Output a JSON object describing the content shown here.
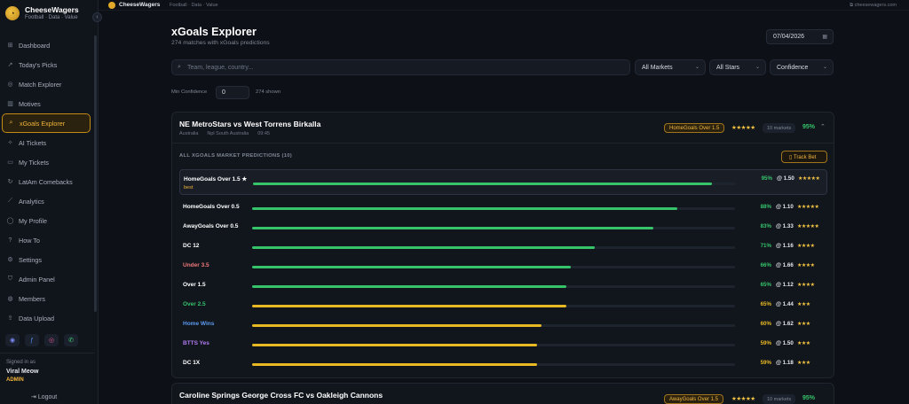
{
  "brand": {
    "name": "CheeseWagers",
    "tagline": "Football · Data · Value"
  },
  "nav": [
    {
      "label": "Dashboard",
      "icon": "grid-icon",
      "glyph": "⊞"
    },
    {
      "label": "Today's Picks",
      "icon": "trend-icon",
      "glyph": "↗"
    },
    {
      "label": "Match Explorer",
      "icon": "compass-icon",
      "glyph": "◎"
    },
    {
      "label": "Motives",
      "icon": "bar-icon",
      "glyph": "▥"
    },
    {
      "label": "xGoals Explorer",
      "icon": "search-icon",
      "glyph": "⌕",
      "active": true
    },
    {
      "label": "AI Tickets",
      "icon": "spark-icon",
      "glyph": "✧"
    },
    {
      "label": "My Tickets",
      "icon": "ticket-icon",
      "glyph": "▭"
    },
    {
      "label": "LatAm Comebacks",
      "icon": "cycle-icon",
      "glyph": "↻"
    },
    {
      "label": "Analytics",
      "icon": "chart-line-icon",
      "glyph": "⟋"
    },
    {
      "label": "My Profile",
      "icon": "user-icon",
      "glyph": "◯"
    },
    {
      "label": "How To",
      "icon": "help-icon",
      "glyph": "?"
    },
    {
      "label": "Settings",
      "icon": "gear-icon",
      "glyph": "⚙"
    },
    {
      "label": "Admin Panel",
      "icon": "shield-icon",
      "glyph": "⛉"
    },
    {
      "label": "Members",
      "icon": "users-icon",
      "glyph": "◍"
    },
    {
      "label": "Data Upload",
      "icon": "upload-icon",
      "glyph": "⇪"
    }
  ],
  "user": {
    "signed_in": "Signed in as",
    "name": "Viral Meow",
    "role": "ADMIN",
    "logout": "Logout"
  },
  "topbar": {
    "name": "CheeseWagers",
    "tagline": "Football · Data · Value",
    "site": "cheesewagers.com"
  },
  "header": {
    "title": "xGoals Explorer",
    "subtitle": "274 matches with xGoals predictions",
    "date": "07/04/2026"
  },
  "filters": {
    "search_placeholder": "Team, league, country...",
    "markets": "All Markets",
    "stars": "All Stars",
    "sort": "Confidence",
    "min_conf_label": "Min Confidence",
    "min_conf_value": "0",
    "shown": "274 shown"
  },
  "match1": {
    "name": "NE MetroStars vs West Torrens Birkalla",
    "country": "Australia",
    "league": "Npl South Australia",
    "time": "09:45",
    "badge": "HomeGoals Over 1.5",
    "stars": "★★★★★",
    "markets": "10 markets",
    "pct": "95%",
    "section": "ALL XGOALS MARKET PREDICTIONS (10)",
    "track": "Track Bet",
    "best_tag": "best",
    "rows": [
      {
        "label": "HomeGoals Over 1.5 ★",
        "value": 95,
        "pct": "95%",
        "odds": "@ 1.50",
        "stars": "★★★★★",
        "color": "#35c46a",
        "label_color": "#ffffff",
        "best": true
      },
      {
        "label": "HomeGoals Over 0.5",
        "value": 88,
        "pct": "88%",
        "odds": "@ 1.10",
        "stars": "★★★★★",
        "color": "#35c46a",
        "label_color": "#ffffff"
      },
      {
        "label": "AwayGoals Over 0.5",
        "value": 83,
        "pct": "83%",
        "odds": "@ 1.33",
        "stars": "★★★★★",
        "color": "#35c46a",
        "label_color": "#ffffff"
      },
      {
        "label": "DC 12",
        "value": 71,
        "pct": "71%",
        "odds": "@ 1.16",
        "stars": "★★★★",
        "color": "#35c46a",
        "label_color": "#ffffff"
      },
      {
        "label": "Under 3.5",
        "value": 66,
        "pct": "66%",
        "odds": "@ 1.66",
        "stars": "★★★★",
        "color": "#35c46a",
        "label_color": "#f07a7a"
      },
      {
        "label": "Over 1.5",
        "value": 65,
        "pct": "65%",
        "odds": "@ 1.12",
        "stars": "★★★★",
        "color": "#35c46a",
        "label_color": "#ffffff"
      },
      {
        "label": "Over 2.5",
        "value": 65,
        "pct": "65%",
        "odds": "@ 1.44",
        "stars": "★★★",
        "color": "#e8b923",
        "label_color": "#35c46a"
      },
      {
        "label": "Home Wins",
        "value": 60,
        "pct": "60%",
        "odds": "@ 1.62",
        "stars": "★★★",
        "color": "#e8b923",
        "label_color": "#5b9bf0"
      },
      {
        "label": "BTTS Yes",
        "value": 59,
        "pct": "59%",
        "odds": "@ 1.50",
        "stars": "★★★",
        "color": "#e8b923",
        "label_color": "#b07cf0"
      },
      {
        "label": "DC 1X",
        "value": 59,
        "pct": "59%",
        "odds": "@ 1.18",
        "stars": "★★★",
        "color": "#e8b923",
        "label_color": "#ffffff"
      }
    ]
  },
  "match2": {
    "name": "Caroline Springs George Cross FC vs Oakleigh Cannons",
    "badge": "AwayGoals Over 1.5",
    "stars": "★★★★★",
    "markets": "10 markets",
    "pct": "95%"
  }
}
